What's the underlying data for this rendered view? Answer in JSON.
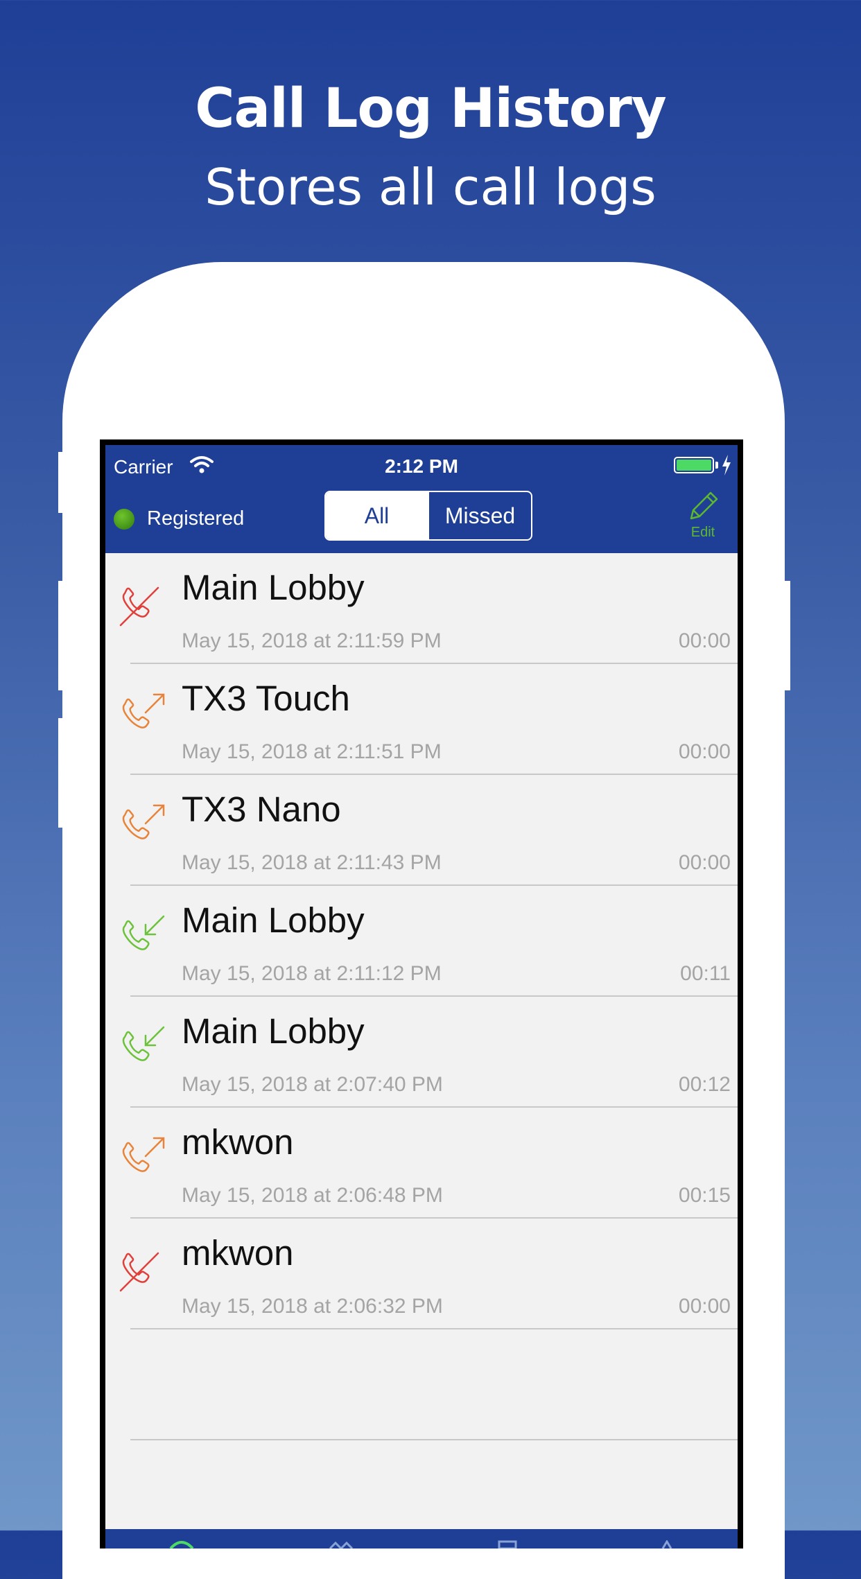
{
  "promo": {
    "title": "Call Log History",
    "subtitle": "Stores all call logs"
  },
  "status_bar": {
    "carrier": "Carrier",
    "time": "2:12 PM"
  },
  "nav": {
    "registration": "Registered",
    "segments": [
      "All",
      "Missed"
    ],
    "selected_segment": "All",
    "edit_label": "Edit"
  },
  "calls": [
    {
      "name": "Main Lobby",
      "date": "May 15, 2018 at 2:11:59 PM",
      "duration": "00:00",
      "type": "missed"
    },
    {
      "name": "TX3 Touch",
      "date": "May 15, 2018 at 2:11:51 PM",
      "duration": "00:00",
      "type": "outgoing"
    },
    {
      "name": "TX3 Nano",
      "date": "May 15, 2018 at 2:11:43 PM",
      "duration": "00:00",
      "type": "outgoing"
    },
    {
      "name": "Main Lobby",
      "date": "May 15, 2018 at 2:11:12 PM",
      "duration": "00:11",
      "type": "incoming"
    },
    {
      "name": "Main Lobby",
      "date": "May 15, 2018 at 2:07:40 PM",
      "duration": "00:12",
      "type": "incoming"
    },
    {
      "name": "mkwon",
      "date": "May 15, 2018 at 2:06:48 PM",
      "duration": "00:15",
      "type": "outgoing"
    },
    {
      "name": "mkwon",
      "date": "May 15, 2018 at 2:06:32 PM",
      "duration": "00:00",
      "type": "missed"
    }
  ],
  "colors": {
    "nav_bg": "#1f3f97",
    "missed": "#e0403a",
    "outgoing": "#e8843a",
    "incoming": "#6cc23a",
    "edit": "#5cb82e"
  },
  "icons": {
    "missed": "missed-call-icon",
    "outgoing": "outgoing-call-icon",
    "incoming": "incoming-call-icon"
  }
}
